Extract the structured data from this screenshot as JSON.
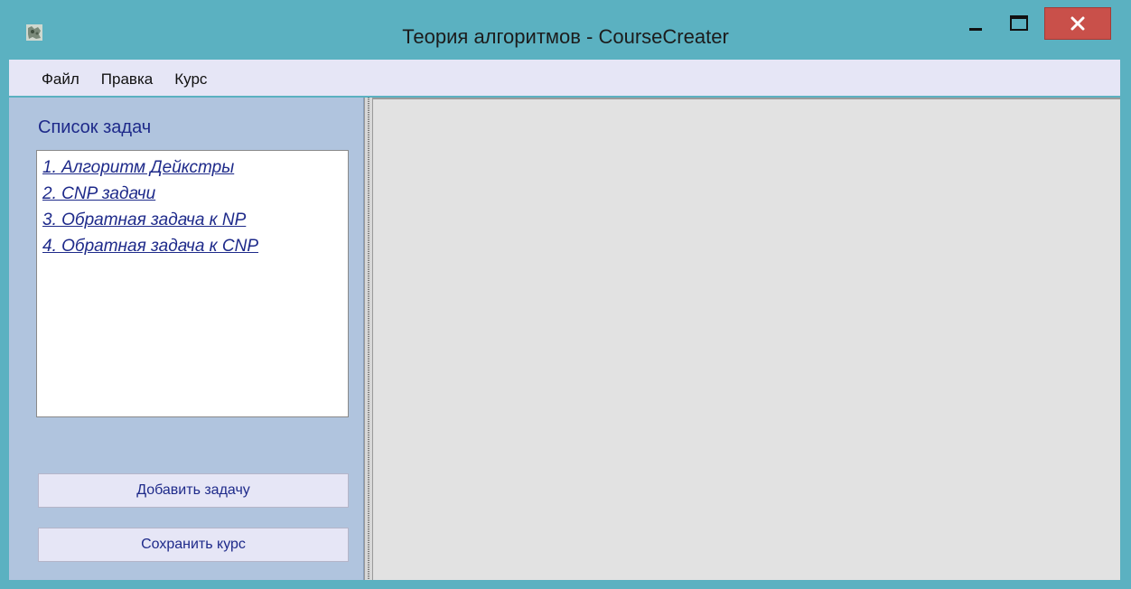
{
  "window": {
    "title": "Теория алгоритмов - CourseCreater",
    "accent_color": "#5bb1c1",
    "close_color": "#c9504a",
    "icons": {
      "app": "app-icon",
      "minimize": "minimize-icon",
      "maximize": "maximize-icon",
      "close": "close-icon"
    }
  },
  "menu": {
    "items": [
      "Файл",
      "Правка",
      "Курс"
    ]
  },
  "tasks_panel": {
    "heading": "Список задач",
    "items": [
      "1. Алгоритм Дейкстры",
      "2. CNP задачи",
      "3. Обратная задача к NP",
      "4. Обратная задача к CNP"
    ],
    "add_button": "Добавить задачу",
    "save_button": "Сохранить курс"
  }
}
